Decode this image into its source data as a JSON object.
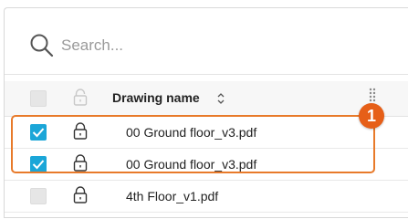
{
  "search": {
    "placeholder": "Search..."
  },
  "table": {
    "column_header": "Drawing name",
    "rows": [
      {
        "name": "00 Ground floor_v3.pdf",
        "selected": true
      },
      {
        "name": "00 Ground floor_v3.pdf",
        "selected": true
      },
      {
        "name": "4th Floor_v1.pdf",
        "selected": false
      }
    ]
  },
  "annotation": {
    "badge": "1"
  },
  "colors": {
    "accent": "#1ba6d8",
    "highlight": "#e87a2a",
    "badge": "#e65f18"
  },
  "icons": [
    "search-icon",
    "lock-icon",
    "sort-icon",
    "drag-handle-icon",
    "check-icon"
  ]
}
